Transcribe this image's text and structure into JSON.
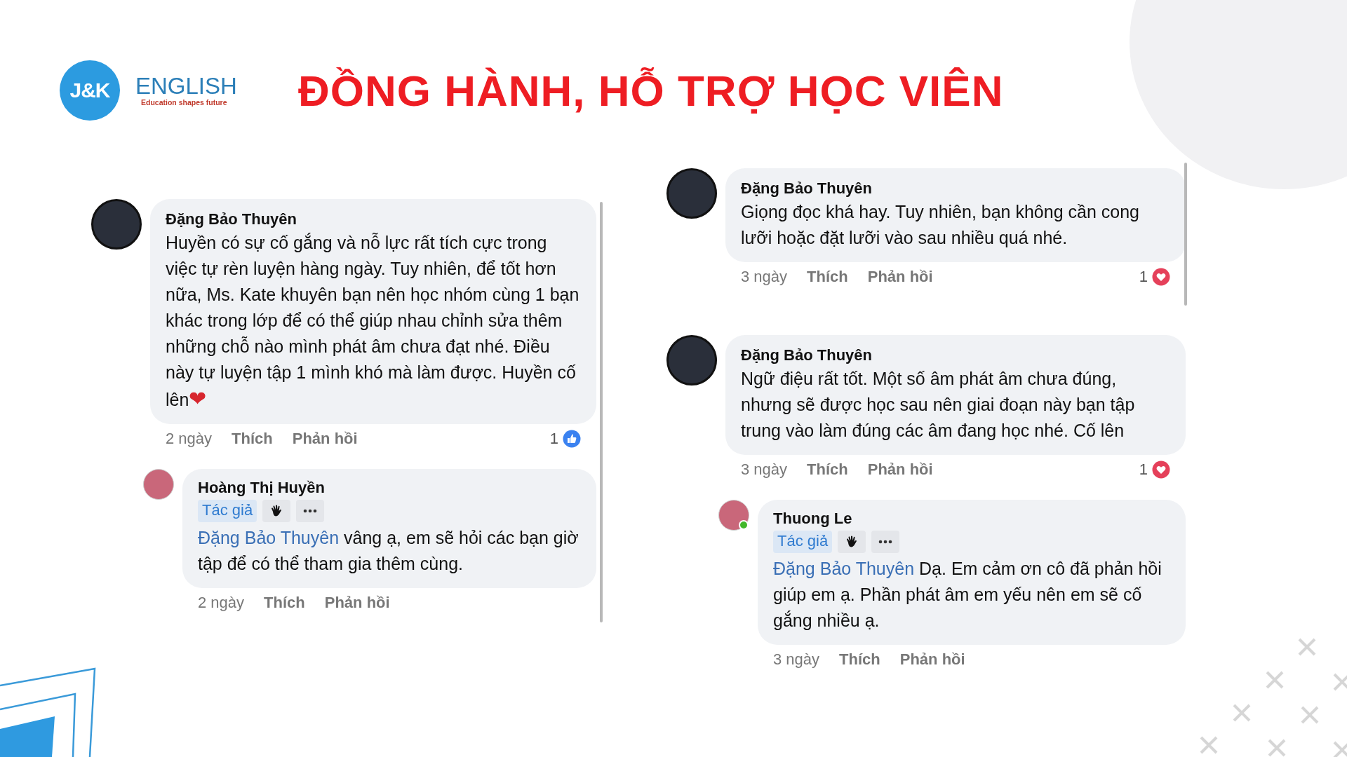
{
  "header": {
    "logo": {
      "mark": "J&K",
      "wordmark": "ENGLISH",
      "tagline": "Education shapes future"
    },
    "title": "ĐỒNG HÀNH, HỖ TRỢ HỌC VIÊN"
  },
  "columns": [
    {
      "comments": [
        {
          "author": "Đặng Bảo Thuyên",
          "online": false,
          "text": "Huyền có sự cố gắng và nỗ lực rất tích cực trong việc tự rèn luyện hàng ngày. Tuy nhiên, để tốt hơn nữa, Ms. Kate khuyên bạn nên học nhóm cùng 1 bạn khác trong lớp để có thể giúp nhau chỉnh sửa thêm những chỗ nào mình phát âm chưa đạt nhé. Điều này tự luyện tập 1 mình khó mà làm được. Huyền cố lên",
          "emoji": "❤",
          "time": "2 ngày",
          "like": "Thích",
          "reply": "Phản hồi",
          "reaction": {
            "kind": "like",
            "count": "1"
          },
          "replies": [
            {
              "author": "Hoàng Thị Huyền",
              "online": false,
              "badge": "Tác giả",
              "mention": "Đặng Bảo Thuyên",
              "text": "vâng ạ, em sẽ hỏi các bạn giờ tập để có thể tham gia thêm cùng.",
              "time": "2 ngày",
              "like": "Thích",
              "reply": "Phản hồi"
            }
          ]
        }
      ]
    },
    {
      "comments": [
        {
          "author": "Đặng Bảo Thuyên",
          "online": false,
          "text": "Giọng đọc khá hay. Tuy nhiên, bạn không cần cong lưỡi hoặc đặt lưỡi vào sau nhiều quá nhé.",
          "time": "3 ngày",
          "like": "Thích",
          "reply": "Phản hồi",
          "reaction": {
            "kind": "love",
            "count": "1"
          }
        },
        {
          "author": "Đặng Bảo Thuyên",
          "online": false,
          "text": "Ngữ điệu rất tốt. Một số âm phát âm chưa đúng, nhưng sẽ được học sau nên giai đoạn này bạn tập trung vào làm đúng các âm đang học nhé. Cố lên",
          "time": "3 ngày",
          "like": "Thích",
          "reply": "Phản hồi",
          "reaction": {
            "kind": "love",
            "count": "1"
          },
          "replies": [
            {
              "author": "Thuong Le",
              "online": true,
              "badge": "Tác giả",
              "mention": "Đặng Bảo Thuyên",
              "text": "Dạ. Em cảm ơn cô đã phản hồi giúp em ạ. Phần phát âm em yếu nên em sẽ cố gắng nhiều ạ.",
              "time": "3 ngày",
              "like": "Thích",
              "reply": "Phản hồi"
            }
          ]
        }
      ]
    }
  ]
}
